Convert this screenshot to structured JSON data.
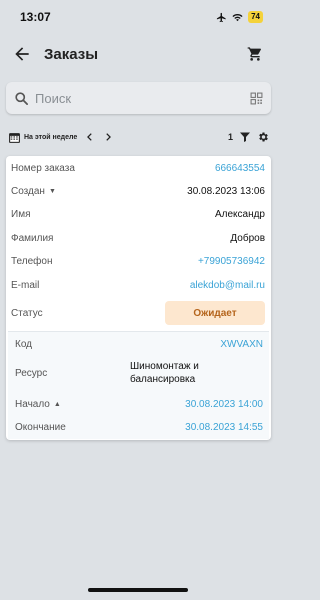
{
  "status_bar": {
    "time": "13:07",
    "battery": "74"
  },
  "header": {
    "title": "Заказы",
    "back_icon": "arrow-left-icon",
    "cart_icon": "cart-icon"
  },
  "search": {
    "placeholder": "Поиск",
    "value": ""
  },
  "filter_bar": {
    "period": "На этой неделе",
    "count": "1"
  },
  "order": {
    "number_label": "Номер заказа",
    "number": "666643554",
    "created_label": "Создан",
    "created": "30.08.2023 13:06",
    "first_name_label": "Имя",
    "first_name": "Александр",
    "last_name_label": "Фамилия",
    "last_name": "Добров",
    "phone_label": "Телефон",
    "phone": "+79905736942",
    "email_label": "E-mail",
    "email": "alekdob@mail.ru",
    "status_label": "Статус",
    "status": "Ожидает"
  },
  "booking": {
    "code_label": "Код",
    "code": "XWVAXN",
    "resource_label": "Ресурс",
    "resource": "Шиномонтаж и балансировка",
    "start_label": "Начало",
    "start": "30.08.2023 14:00",
    "end_label": "Окончание",
    "end": "30.08.2023 14:55"
  },
  "colors": {
    "link": "#3aa3d6",
    "status_bg": "#fde7cf",
    "status_text": "#b5651d",
    "background": "#dde1e5"
  }
}
